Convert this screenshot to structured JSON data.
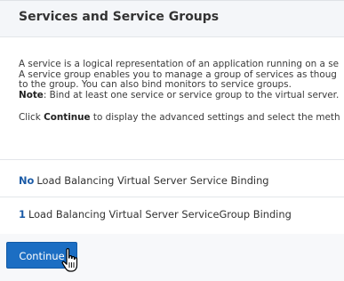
{
  "section": {
    "title": "Services and Service Groups"
  },
  "description": {
    "line1": "A service is a logical representation of an application running on a se",
    "line2": "A service group enables you to manage a group of services as thoug",
    "line3": "to the group. You can also bind monitors to service groups.",
    "note_label": "Note",
    "note_text": ": Bind at least one service or service group to the virtual server.",
    "continue_pre": "Click ",
    "continue_bold": "Continue",
    "continue_post": " to display the advanced settings and select the meth"
  },
  "bindings": [
    {
      "count": "No",
      "label": "Load Balancing Virtual Server Service Binding"
    },
    {
      "count": "1",
      "label": "Load Balancing Virtual Server ServiceGroup Binding"
    }
  ],
  "actions": {
    "continue_label": "Continue"
  },
  "colors": {
    "accent": "#1c6ec3",
    "count_link": "#1a5aa6"
  },
  "cursor": "hand-pointer-icon"
}
